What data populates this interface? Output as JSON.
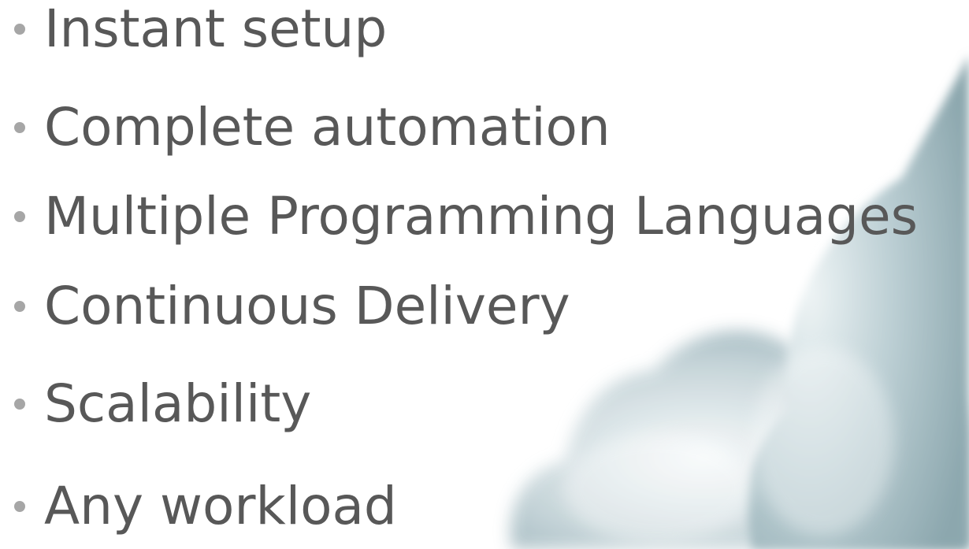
{
  "slide": {
    "bullets": [
      "Instant setup",
      "Complete automation",
      "Multiple Programming Languages",
      "Continuous Delivery",
      "Scalability",
      "Any workload"
    ]
  },
  "colors": {
    "text": "#585858",
    "bullet_dot": "#a6a6a6",
    "cloud_dark": "#9fb5bc",
    "cloud_light": "#eef3f4"
  },
  "icons": [
    "cloud-illustration",
    "bullet-dot"
  ]
}
